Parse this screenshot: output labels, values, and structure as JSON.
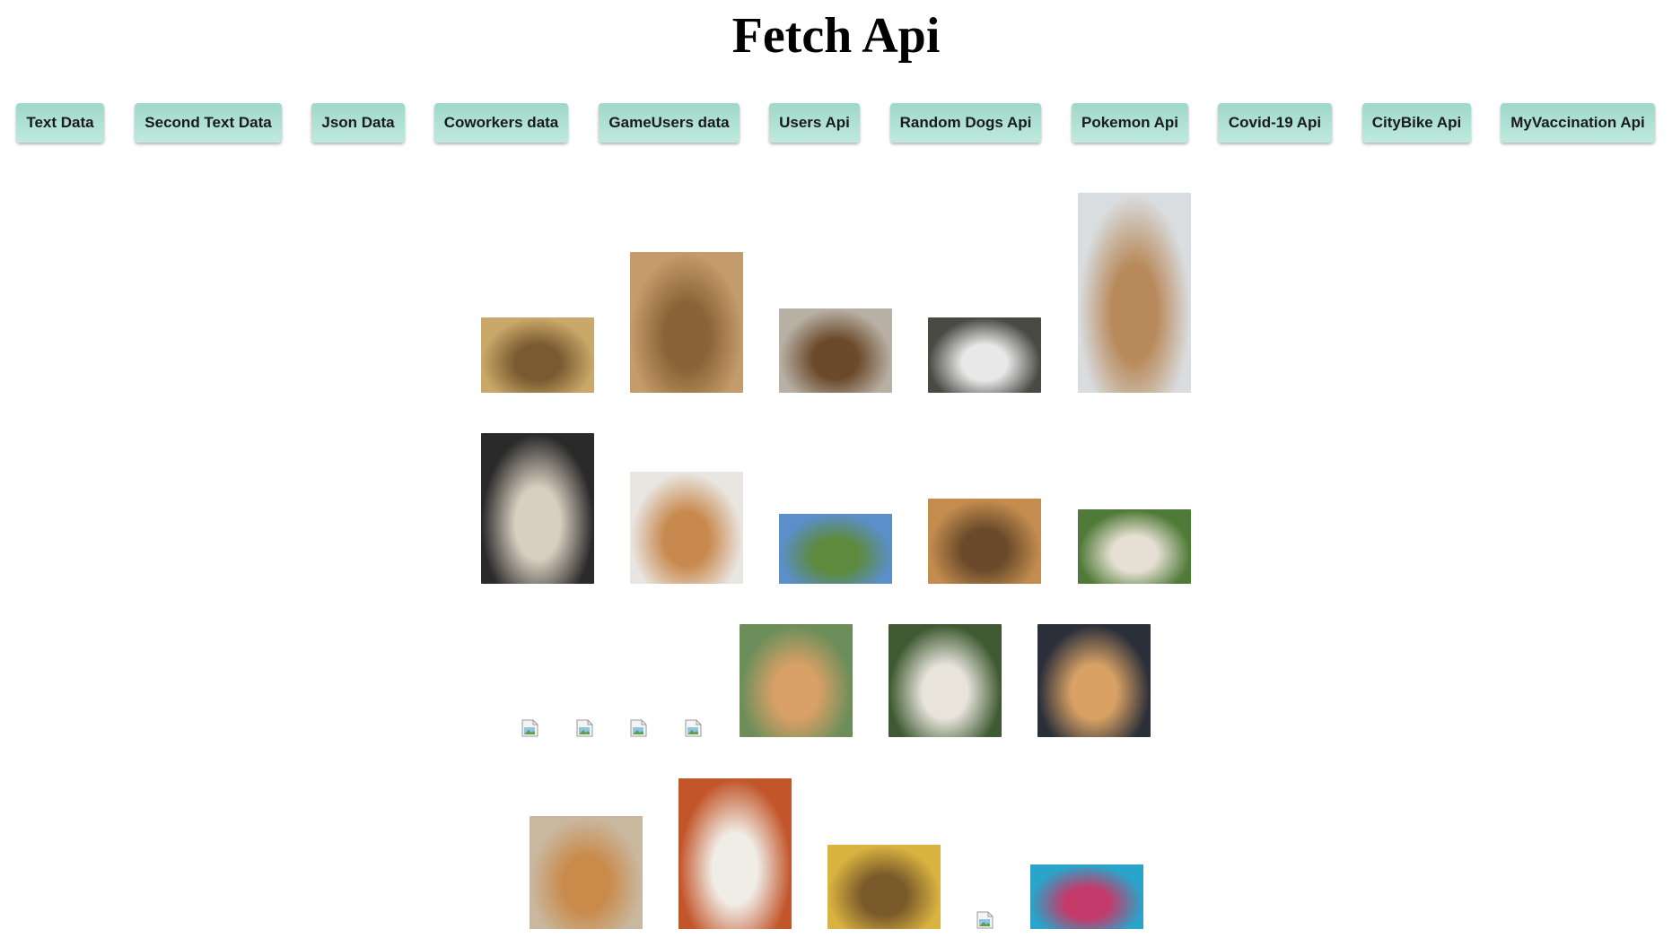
{
  "page": {
    "title": "Fetch Api"
  },
  "buttons": [
    {
      "label": "Text Data"
    },
    {
      "label": "Second Text Data"
    },
    {
      "label": "Json Data"
    },
    {
      "label": "Coworkers data"
    },
    {
      "label": "GameUsers data"
    },
    {
      "label": "Users Api"
    },
    {
      "label": "Random Dogs Api"
    },
    {
      "label": "Pokemon Api"
    },
    {
      "label": "Covid-19 Api"
    },
    {
      "label": "CityBike Api"
    },
    {
      "label": "MyVaccination Api"
    }
  ],
  "dog_images": [
    {
      "subject": "two-dogs-on-grass",
      "palette": [
        "#c9a86a",
        "#7a5a30"
      ]
    },
    {
      "subject": "fluffy-chow-puppy",
      "palette": [
        "#c49b6a",
        "#8a6438"
      ]
    },
    {
      "subject": "dogs-on-beach",
      "palette": [
        "#b8b0a4",
        "#6b4a2c"
      ]
    },
    {
      "subject": "husky-puppy-on-rocks",
      "palette": [
        "#4a4a45",
        "#e8e8e8"
      ]
    },
    {
      "subject": "golden-retriever-behind-gate",
      "palette": [
        "#d9dde0",
        "#b8895a"
      ]
    },
    {
      "subject": "black-tan-hound",
      "palette": [
        "#2a2a2a",
        "#d9cfc0"
      ]
    },
    {
      "subject": "shiba-face-closeup",
      "palette": [
        "#e9e6e2",
        "#c8894e"
      ]
    },
    {
      "subject": "dog-with-goggles-road",
      "palette": [
        "#5b8fc9",
        "#5d8a3c"
      ]
    },
    {
      "subject": "small-dog-on-floor",
      "palette": [
        "#c48d4f",
        "#6a4a2a"
      ]
    },
    {
      "subject": "white-dog-in-field",
      "palette": [
        "#4f7a37",
        "#e6e0d4"
      ]
    },
    {
      "subject": "broken-image",
      "broken": true
    },
    {
      "subject": "broken-image",
      "broken": true
    },
    {
      "subject": "broken-image",
      "broken": true
    },
    {
      "subject": "broken-image",
      "broken": true
    },
    {
      "subject": "shiba-on-street",
      "palette": [
        "#6b8e5a",
        "#d9a067"
      ]
    },
    {
      "subject": "white-dog-collage",
      "palette": [
        "#3f5a32",
        "#e8e4dc"
      ]
    },
    {
      "subject": "smiling-shiba",
      "palette": [
        "#2b2f3a",
        "#d9a264"
      ]
    },
    {
      "subject": "shiba-lying-on-phone",
      "palette": [
        "#c9b8a0",
        "#c98a4a"
      ]
    },
    {
      "subject": "dog-nose-closeup",
      "palette": [
        "#c2562a",
        "#f0ece6"
      ]
    },
    {
      "subject": "dog-at-desk",
      "palette": [
        "#d9b340",
        "#7a5a2a"
      ]
    },
    {
      "subject": "broken-image",
      "broken": true
    },
    {
      "subject": "dog-in-pool",
      "palette": [
        "#2aa4c9",
        "#c43a6a"
      ]
    }
  ]
}
